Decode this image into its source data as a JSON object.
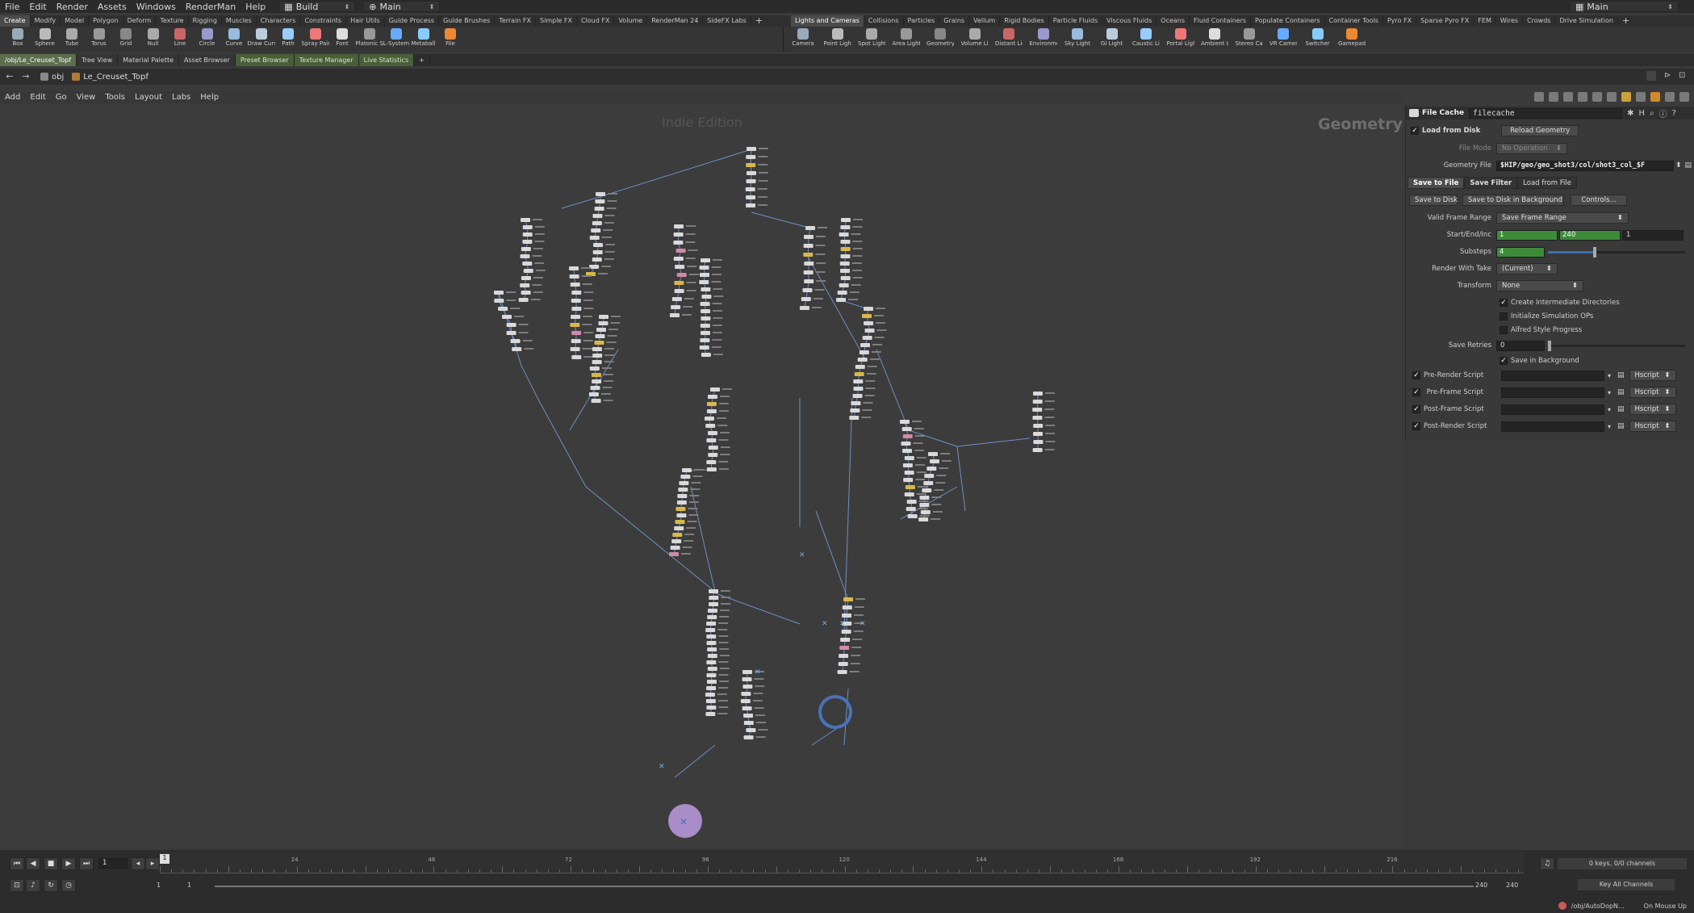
{
  "menubar": {
    "items": [
      "File",
      "Edit",
      "Render",
      "Assets",
      "Windows",
      "RenderMan",
      "Help"
    ],
    "desktop": "Build",
    "context": "Main",
    "right_context": "Main"
  },
  "shelf_left": {
    "tabs": [
      "Create",
      "Modify",
      "Model",
      "Polygon",
      "Deform",
      "Texture",
      "Rigging",
      "Muscles",
      "Characters",
      "Constraints",
      "Hair Utils",
      "Guide Process",
      "Guide Brushes",
      "Terrain FX",
      "Simple FX",
      "Cloud FX",
      "Volume",
      "RenderMan 24",
      "SideFX Labs"
    ],
    "active": "Create",
    "tools": [
      "Box",
      "Sphere",
      "Tube",
      "Torus",
      "Grid",
      "Null",
      "Line",
      "Circle",
      "Curve",
      "Draw Curve",
      "Path",
      "Spray Paint",
      "Font",
      "Platonic Solids",
      "L-System",
      "Metaball",
      "File"
    ]
  },
  "shelf_right": {
    "tabs": [
      "Lights and Cameras",
      "Collisions",
      "Particles",
      "Grains",
      "Vellum",
      "Rigid Bodies",
      "Particle Fluids",
      "Viscous Fluids",
      "Oceans",
      "Fluid Containers",
      "Populate Containers",
      "Container Tools",
      "Pyro FX",
      "Sparse Pyro FX",
      "FEM",
      "Wires",
      "Crowds",
      "Drive Simulation"
    ],
    "active": "Lights and Cameras",
    "tools": [
      "Camera",
      "Point Light",
      "Spot Light",
      "Area Light",
      "Geometry Light",
      "Volume Light",
      "Distant Light",
      "Environment Light",
      "Sky Light",
      "GI Light",
      "Caustic Light",
      "Portal Light",
      "Ambient Light",
      "Stereo Camera",
      "VR Camera",
      "Switcher",
      "Gamepad Camera"
    ]
  },
  "pane_tabs": [
    "/obj/Le_Creuset_Topf",
    "Tree View",
    "Material Palette",
    "Asset Browser",
    "Preset Browser",
    "Texture Manager",
    "Live Statistics"
  ],
  "path": {
    "root": "obj",
    "node": "Le_Creuset_Topf"
  },
  "network_menu": [
    "Add",
    "Edit",
    "Go",
    "View",
    "Tools",
    "Layout",
    "Labs",
    "Help"
  ],
  "network": {
    "watermark": "Indie Edition",
    "context_label": "Geometry"
  },
  "params": {
    "node_type": "File Cache",
    "node_name": "filecache",
    "load_from_disk": "Load from Disk",
    "reload_button": "Reload Geometry",
    "file_mode_label": "File Mode",
    "file_mode_value": "No Operation",
    "geometry_file_label": "Geometry File",
    "geometry_file_value": "$HIP/geo/geo_shot3/col/shot3_col_$F",
    "tabs": [
      "Save to File",
      "Save Filter",
      "Load from File"
    ],
    "active_tab": "Save to File",
    "save_to_disk": "Save to Disk",
    "save_background": "Save to Disk in Background",
    "controls": "Controls...",
    "valid_frame_range_label": "Valid Frame Range",
    "valid_frame_range_value": "Save Frame Range",
    "start_end_inc_label": "Start/End/Inc",
    "start": "1",
    "end": "240",
    "inc": "1",
    "substeps_label": "Substeps",
    "substeps": "4",
    "render_with_take_label": "Render With Take",
    "render_with_take_value": "(Current)",
    "transform_label": "Transform",
    "transform_value": "None",
    "opt_create_dirs": "Create Intermediate Directories",
    "opt_init_sim": "Initialize Simulation OPs",
    "opt_alfred": "Alfred Style Progress",
    "save_retries_label": "Save Retries",
    "save_retries": "0",
    "save_in_background": "Save in Background",
    "scripts": [
      "Pre-Render Script",
      "Pre-Frame Script",
      "Post-Frame Script",
      "Post-Render Script"
    ],
    "script_lang": "Hscript"
  },
  "timeline": {
    "frame": "1",
    "ticks": [
      "24",
      "48",
      "72",
      "96",
      "120",
      "144",
      "168",
      "192",
      "216"
    ],
    "range_start": "1",
    "range_start2": "1",
    "range_end": "240",
    "range_end2": "240",
    "keys_info": "0 keys, 0/0 channels",
    "key_all": "Key All Channels",
    "status_path": "/obj/AutoDopN...",
    "on_mouse": "On Mouse Up"
  }
}
